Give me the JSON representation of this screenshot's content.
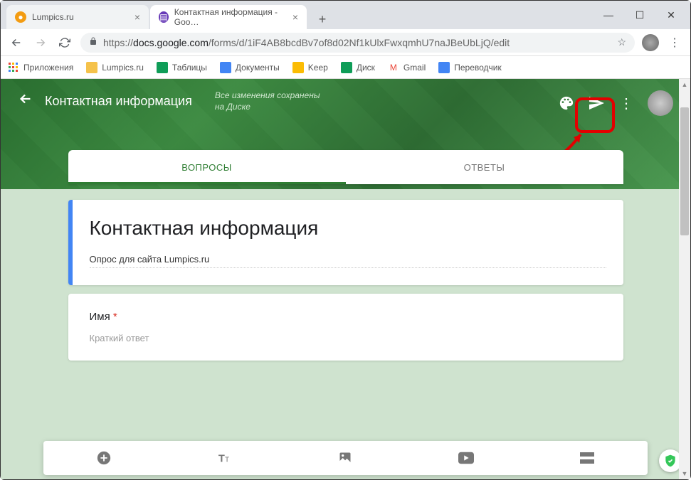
{
  "window": {
    "minimize": "—",
    "maximize": "☐",
    "close": "✕"
  },
  "tabs": [
    {
      "title": "Lumpics.ru",
      "favicon_color": "#f39c12",
      "active": false
    },
    {
      "title": "Контактная информация - Goo…",
      "favicon_color": "#673ab7",
      "active": true
    }
  ],
  "address": {
    "scheme": "https://",
    "host": "docs.google.com",
    "path": "/forms/d/1iF4AB8bcdBv7of8d02Nf1kUlxFwxqmhU7naJBeUbLjQ/edit"
  },
  "bookmarks": [
    {
      "label": "Приложения",
      "icon": "apps",
      "color": ""
    },
    {
      "label": "Lumpics.ru",
      "icon": "folder",
      "color": "#f5c24b"
    },
    {
      "label": "Таблицы",
      "icon": "sheets",
      "color": "#0f9d58"
    },
    {
      "label": "Документы",
      "icon": "docs",
      "color": "#4285f4"
    },
    {
      "label": "Keep",
      "icon": "keep",
      "color": "#fbbc04"
    },
    {
      "label": "Диск",
      "icon": "drive",
      "color": "#0f9d58"
    },
    {
      "label": "Gmail",
      "icon": "gmail",
      "color": "#ea4335"
    },
    {
      "label": "Переводчик",
      "icon": "translate",
      "color": "#4285f4"
    }
  ],
  "forms_header": {
    "title": "Контактная информация",
    "status": "Все изменения сохранены на Диске"
  },
  "form_tabs": {
    "questions": "ВОПРОСЫ",
    "responses": "ОТВЕТЫ"
  },
  "form": {
    "title": "Контактная информация",
    "description": "Опрос для сайта Lumpics.ru",
    "q1_label": "Имя",
    "q1_required": "*",
    "q1_placeholder": "Краткий ответ"
  }
}
